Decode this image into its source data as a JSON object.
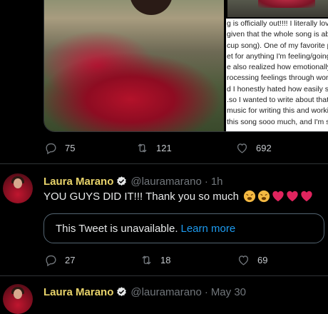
{
  "tweet_top": {
    "caption_lines": [
      "g is officially out!!!! I literally love th",
      "given that the whole song is about m",
      "cup song). One of my favorite parts",
      "et for anything I'm feeling/going thro",
      "e also realized how emotionally exh",
      "rocessing feelings through work. I h",
      "d I honestly hated how easily sad sc",
      ".so I wanted to write about that 😊",
      "music for writing this and working o",
      "this song sooo much, and I'm so ha"
    ],
    "actions": {
      "reply": "75",
      "retweet": "121",
      "like": "692"
    }
  },
  "tweet_main": {
    "name": "Laura Marano",
    "handle": "@lauramarano",
    "separator": "·",
    "time": "1h",
    "text": "YOU GUYS DID IT!!! Thank you so much",
    "emojis": [
      "tired-face",
      "tired-face",
      "red-heart",
      "red-heart",
      "red-heart"
    ],
    "quote": {
      "text": "This Tweet is unavailable.",
      "link": "Learn more"
    },
    "actions": {
      "reply": "27",
      "retweet": "18",
      "like": "69"
    }
  },
  "tweet_bottom": {
    "name": "Laura Marano",
    "handle": "@lauramarano",
    "separator": "·",
    "time": "May 30"
  },
  "colors": {
    "background": "#000000",
    "name": "#e8d36a",
    "link": "#1d9bf0",
    "muted": "#71767b",
    "heart": "#e0245e"
  }
}
